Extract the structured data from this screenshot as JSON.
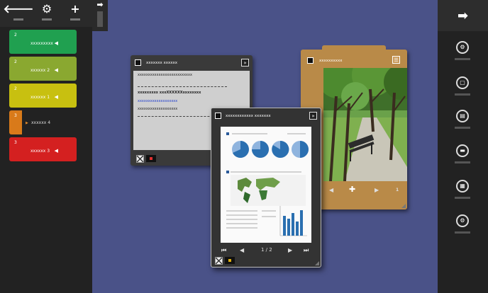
{
  "left_toolbar": {
    "back_icon": "arrow-left-icon",
    "settings_icon": "gear-icon",
    "add_icon": "plus-icon",
    "back_glyph": "🡐",
    "settings_glyph": "⚙",
    "add_glyph": "+",
    "collapse_glyph": "➡"
  },
  "folders": [
    {
      "num": "2",
      "name": "xxxxxxxxx",
      "color": "#20a050"
    },
    {
      "num": "2",
      "name": "xxxxxx 2",
      "color": "#8aa830"
    },
    {
      "num": "2",
      "name": "xxxxxx 1",
      "color": "#c8c010"
    },
    {
      "num": "3",
      "name": "xxxxxx 4",
      "color": "#d97a1a"
    },
    {
      "num": "3",
      "name": "xxxxxx 3",
      "color": "#d42020"
    }
  ],
  "folder_arrow": "◀",
  "folder_arrow_right": "▶",
  "notes_card": {
    "title": "xxxxxxx xxxxxx",
    "lines": [
      "xxxxxxxxxxxxxxxxxxxxxxxxxx",
      "xxxxxxxxx xxxXXXXXXxxxxxxxx",
      "xxxxxxxxxxxxxxxxxxx",
      "xxxxxxxxxxxxxxxxxxx"
    ],
    "collapse": "»"
  },
  "photo_card": {
    "title": "xxxxxxxxxx",
    "page": "1",
    "prev": "◀",
    "next": "▶",
    "add": "✚",
    "menu": "☰"
  },
  "doc_card": {
    "title": "xxxxxxxxxxxx xxxxxxx",
    "pager": "1 / 2",
    "first": "⏮",
    "prev": "◀",
    "next": "▶",
    "last": "⏭",
    "collapse": "»"
  },
  "right_sidebar": {
    "top_glyph": "➡",
    "buttons": [
      {
        "icon": "network-icon",
        "glyph": "⚙"
      },
      {
        "icon": "window-icon",
        "glyph": "▢"
      },
      {
        "icon": "document-icon",
        "glyph": "▤"
      },
      {
        "icon": "printer-icon",
        "glyph": "▬"
      },
      {
        "icon": "grid-icon",
        "glyph": "▦"
      },
      {
        "icon": "settings-icon",
        "glyph": "⚙"
      }
    ]
  },
  "colors": {
    "background": "#4a5288",
    "panel": "#222222",
    "card_dark": "#3a3a3a",
    "cork": "#b98a48"
  }
}
